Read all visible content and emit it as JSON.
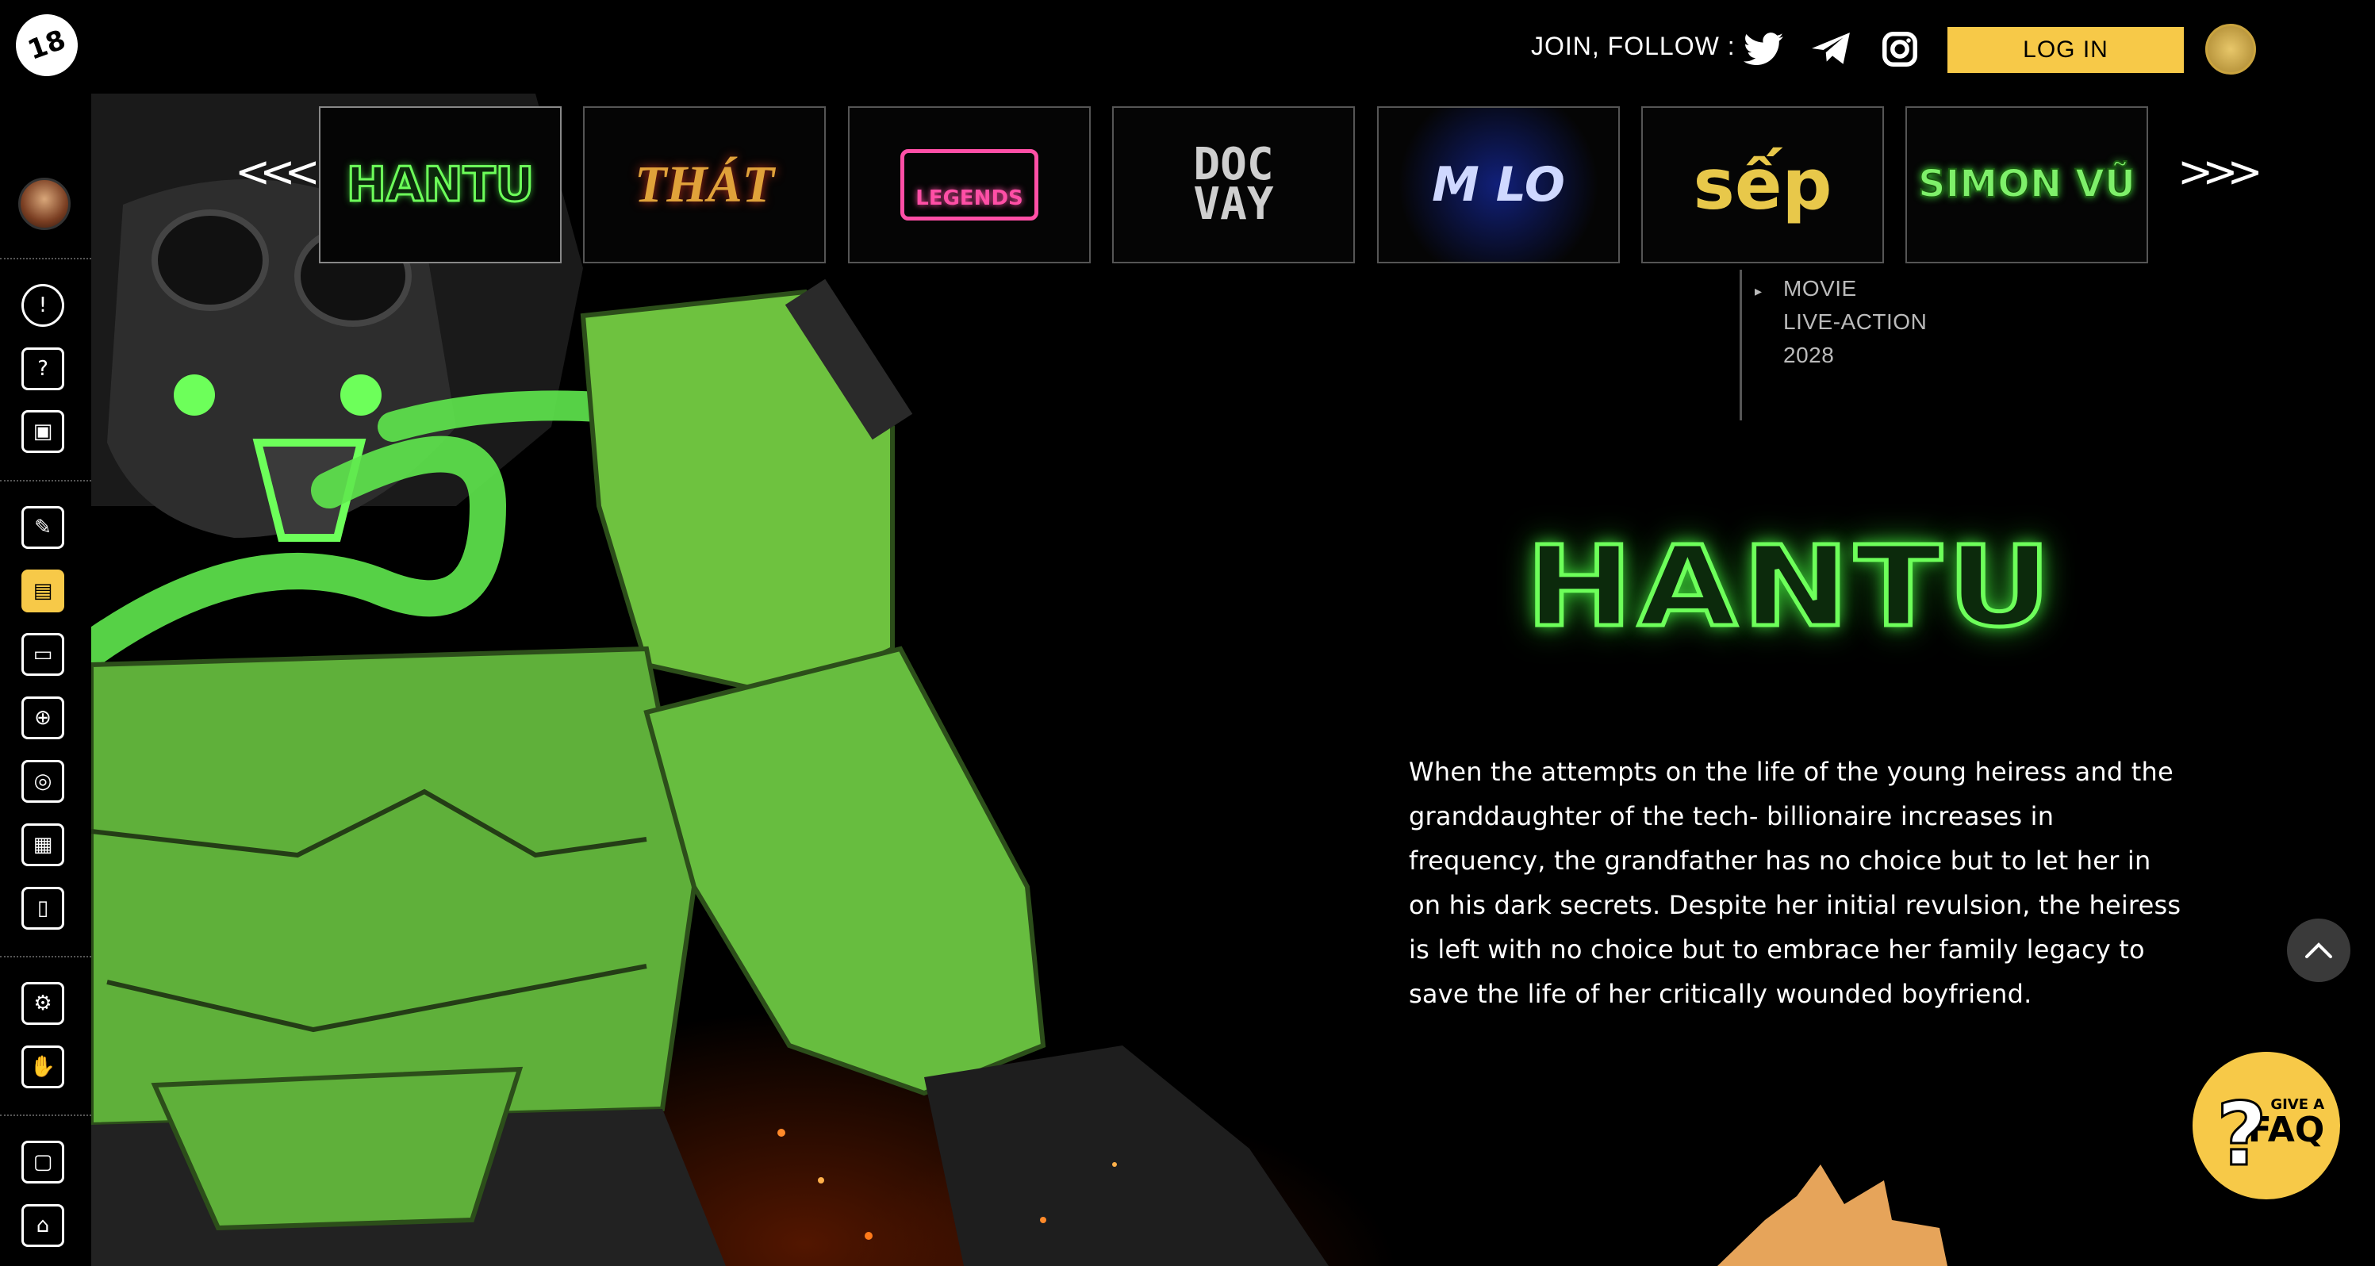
{
  "header": {
    "brand_logo_text": "18",
    "join_label": "JOIN, FOLLOW :",
    "social_icons": [
      "twitter-icon",
      "telegram-icon",
      "instagram-icon"
    ],
    "login_label": "LOG IN"
  },
  "sidebar": {
    "icons": [
      "exclamation-icon",
      "question-icon",
      "mobile-icon",
      "scroll-icon",
      "clapperboard-icon",
      "video-icon",
      "gamepad-icon",
      "fingerprint-icon",
      "gallery-icon",
      "book-icon",
      "gear-icon",
      "handshake-icon",
      "chat-icon",
      "home-icon"
    ],
    "active_icon": "clapperboard-icon"
  },
  "carousel": {
    "prev_label": "<<<",
    "next_label": ">>>",
    "items": [
      {
        "label": "HANTU",
        "color": "#6dff5a"
      },
      {
        "label": "THÁT",
        "color": "#e0a23a"
      },
      {
        "label": "LEGENDS",
        "color": "#ff4fa6"
      },
      {
        "label": "DOC VAY",
        "color": "#cfcfcf"
      },
      {
        "label": "M LO",
        "color": "#cfd8ff"
      },
      {
        "label": "sếp",
        "color": "#e8c84a"
      },
      {
        "label": "SIMON VŨ",
        "color": "#7ef06a"
      }
    ],
    "selected_index": 0
  },
  "meta": {
    "items": [
      "MOVIE",
      "LIVE-ACTION",
      "2028"
    ]
  },
  "title": {
    "logo_text": "HANTU"
  },
  "description": "When the attempts on the life of the young heiress and the granddaughter of the tech- billionaire increases in frequency, the grandfather has no choice but to let her in on his dark secrets. Despite her initial revulsion, the heiress is left with no choice but to embrace her family legacy to save the life of her critically wounded boyfriend.",
  "faq": {
    "give_label": "GIVE A",
    "faq_label": "FAQ",
    "question_mark": "?"
  },
  "colors": {
    "accent": "#f7c948",
    "glow_green": "#6dff5a",
    "background": "#000000"
  }
}
